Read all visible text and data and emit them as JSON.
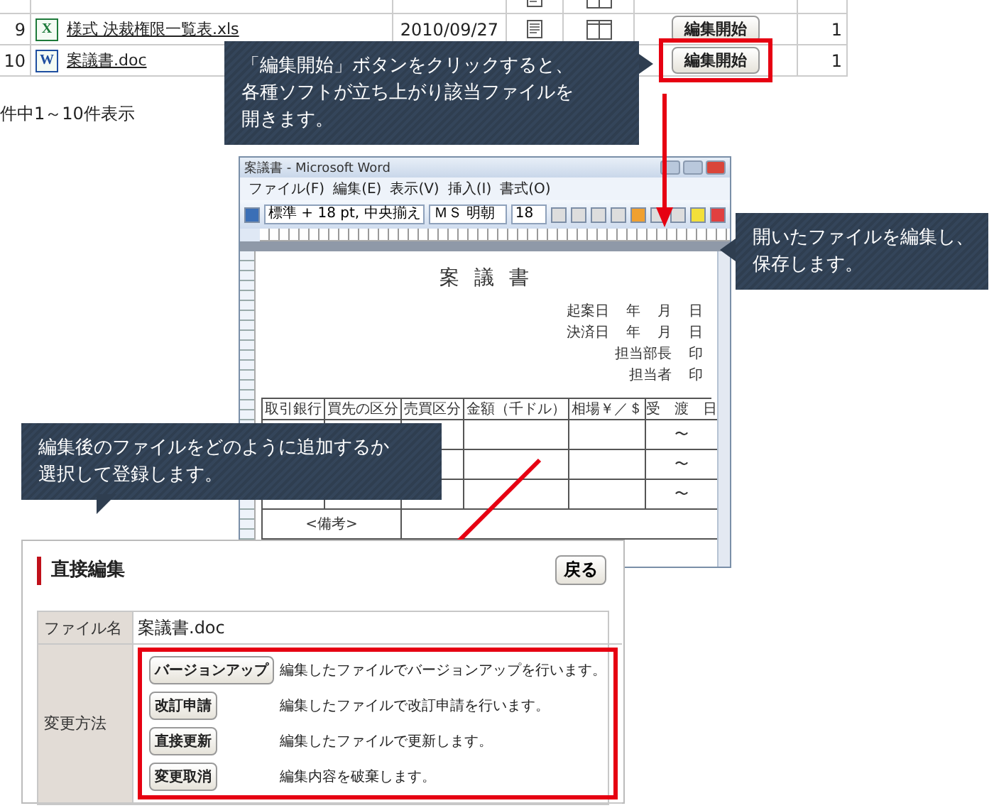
{
  "file_table": {
    "rows": [
      {
        "number": "9",
        "color": "#1d7a3a",
        "icon_label": "X",
        "name": "様式 決裁権限一覧表.xls",
        "date": "2010/09/27",
        "action": "編集開始",
        "count": "1",
        "highlighted": false,
        "icons": true
      },
      {
        "number": "10",
        "color": "#1f4fa0",
        "icon_label": "W",
        "name": "案議書.doc",
        "action": "編集開始",
        "count": "1",
        "highlighted": true,
        "icons": false
      }
    ],
    "summary": "件中1～10件表示"
  },
  "callouts": [
    {
      "lines": [
        "「編集開始」ボタンをクリックすると、",
        "各種ソフトが立ち上がり該当ファイルを",
        "開きます。"
      ]
    },
    {
      "lines": [
        "開いたファイルを編集し、",
        "保存します。"
      ]
    },
    {
      "lines": [
        "編集後のファイルをどのように追加するか",
        "選択して登録します。"
      ]
    }
  ],
  "word_window": {
    "title": "案議書 - Microsoft Word",
    "menus": [
      "ファイル(F)",
      "編集(E)",
      "表示(V)",
      "挿入(I)",
      "書式(O)"
    ],
    "style_box": "標準 + 18 pt, 中央揃え",
    "font_box": "ＭＳ 明朝",
    "size_box": "18",
    "document": {
      "title": "案 議 書",
      "dates": [
        {
          "label": "起案日",
          "year": "年",
          "month": "月",
          "day": "日"
        },
        {
          "label": "決済日",
          "year": "年",
          "month": "月",
          "day": "日"
        }
      ],
      "approvers": [
        {
          "label": "担当部長",
          "seal": "印"
        },
        {
          "label": "担当者",
          "seal": "印"
        }
      ],
      "table_headers": [
        "取引銀行",
        "買先の区分",
        "売買区分",
        "金額（千ドル）",
        "相場￥／＄",
        "受　渡　日"
      ],
      "range_marks": [
        "〜",
        "〜",
        "〜"
      ],
      "note": "<備考>"
    }
  },
  "direct_edit": {
    "title": "直接編集",
    "back_button": "戻る",
    "file_label": "ファイル名",
    "file_name": "案議書.doc",
    "method_label": "変更方法",
    "highlighted": true,
    "methods": [
      {
        "button": "バージョンアップ",
        "description": "編集したファイルでバージョンアップを行います。"
      },
      {
        "button": "改訂申請",
        "description": "編集したファイルで改訂申請を行います。"
      },
      {
        "button": "直接更新",
        "description": "編集したファイルで更新します。"
      },
      {
        "button": "変更取消",
        "description": "編集内容を破棄します。"
      }
    ]
  }
}
